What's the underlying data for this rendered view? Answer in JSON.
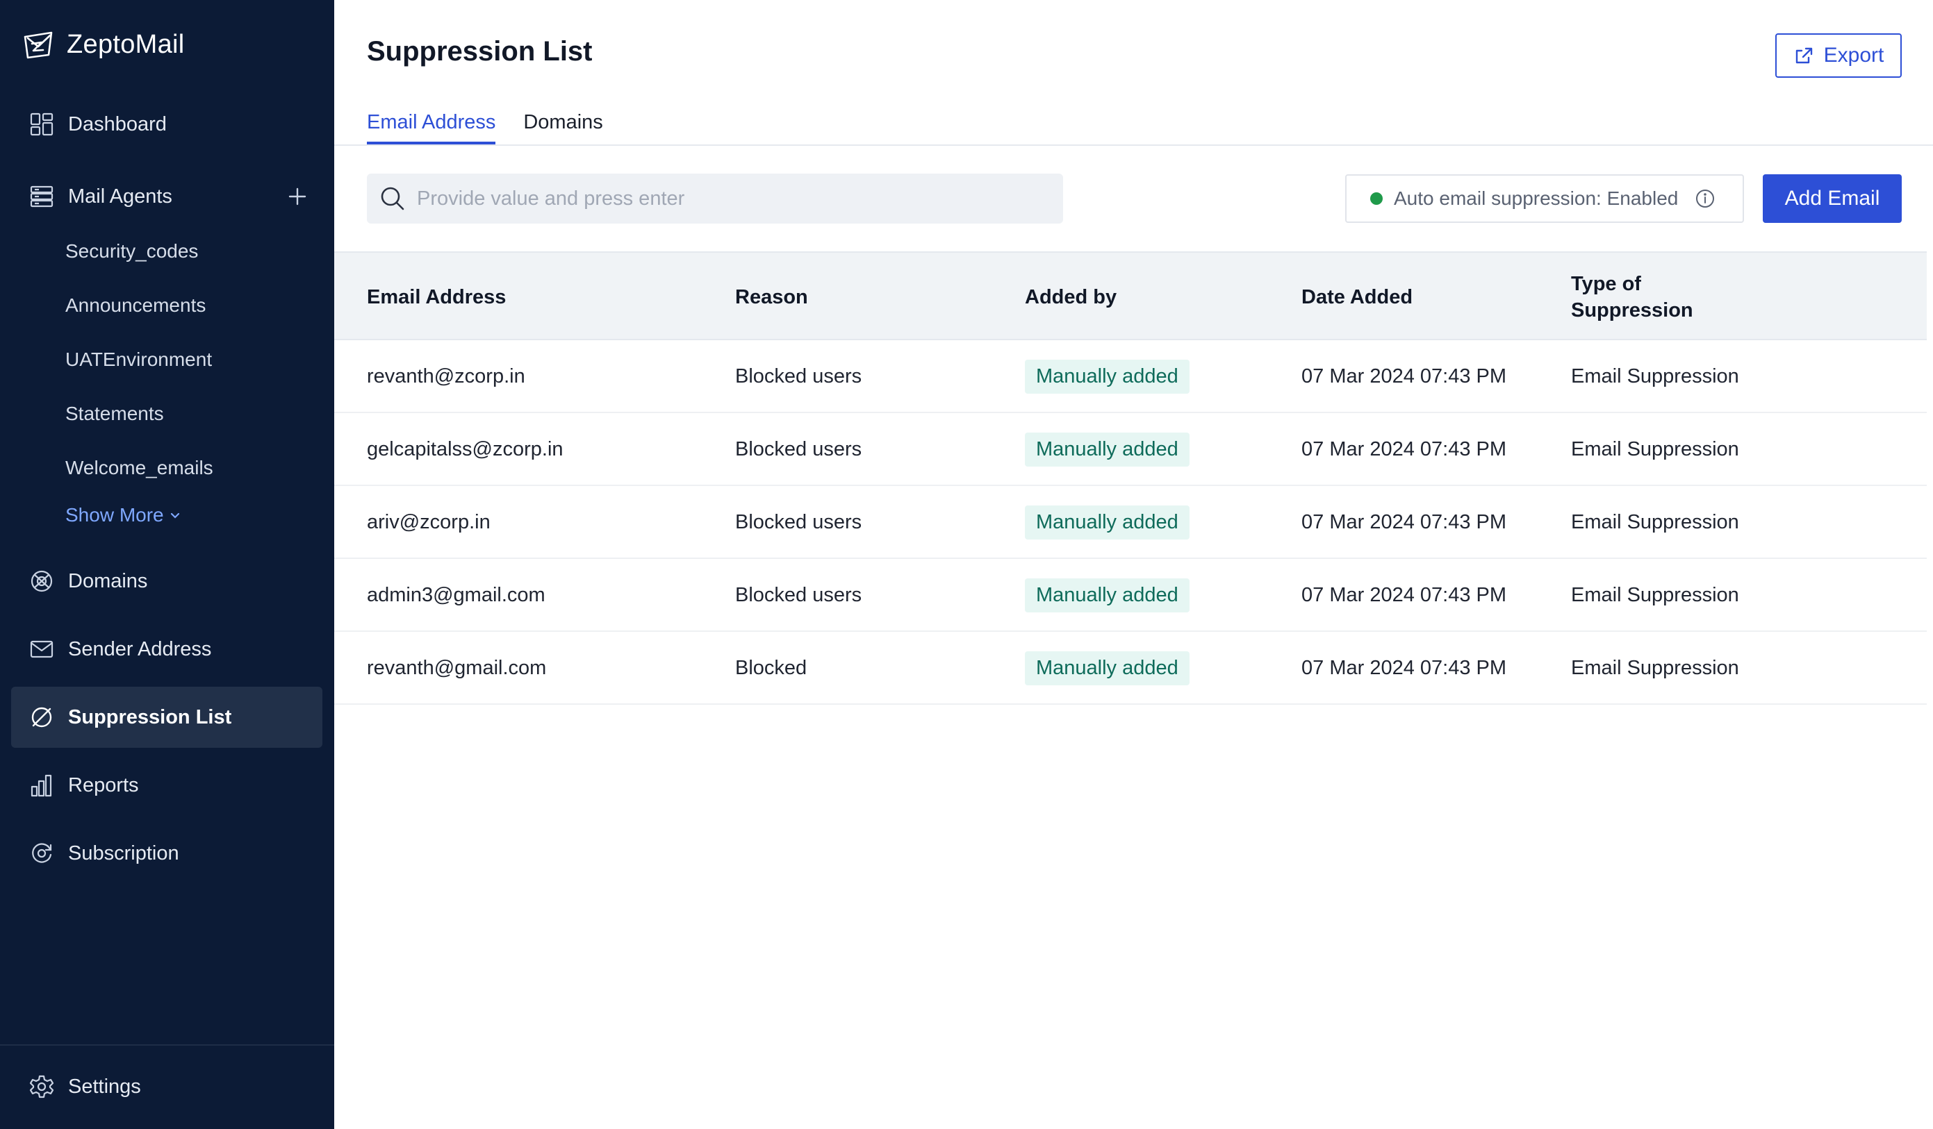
{
  "app": {
    "name": "ZeptoMail"
  },
  "sidebar": {
    "items": [
      {
        "label": "Dashboard",
        "icon": "dashboard-icon"
      },
      {
        "label": "Mail Agents",
        "icon": "mail-agents-icon"
      },
      {
        "label": "Domains",
        "icon": "domains-icon"
      },
      {
        "label": "Sender Address",
        "icon": "envelope-icon"
      },
      {
        "label": "Suppression List",
        "icon": "suppression-icon",
        "active": true
      },
      {
        "label": "Reports",
        "icon": "reports-icon"
      },
      {
        "label": "Subscription",
        "icon": "subscription-icon"
      }
    ],
    "agents": [
      "Security_codes",
      "Announcements",
      "UATEnvironment",
      "Statements",
      "Welcome_emails"
    ],
    "show_more": "Show More",
    "settings": "Settings"
  },
  "main": {
    "title": "Suppression List",
    "export_label": "Export",
    "tabs": [
      "Email Address",
      "Domains"
    ],
    "search_placeholder": "Provide value and press enter",
    "auto_suppression": "Auto email suppression: Enabled",
    "add_email": "Add Email",
    "columns": [
      "Email Address",
      "Reason",
      "Added by",
      "Date Added",
      "Type of Suppression"
    ],
    "rows": [
      {
        "email": "revanth@zcorp.in",
        "reason": "Blocked users",
        "added_by": "Manually added",
        "date": "07 Mar 2024 07:43 PM",
        "type": "Email Suppression"
      },
      {
        "email": "gelcapitalss@zcorp.in",
        "reason": "Blocked users",
        "added_by": "Manually added",
        "date": "07 Mar 2024 07:43 PM",
        "type": "Email Suppression"
      },
      {
        "email": "ariv@zcorp.in",
        "reason": "Blocked users",
        "added_by": "Manually added",
        "date": "07 Mar 2024 07:43 PM",
        "type": "Email Suppression"
      },
      {
        "email": "admin3@gmail.com",
        "reason": "Blocked users",
        "added_by": "Manually added",
        "date": "07 Mar 2024 07:43 PM",
        "type": "Email Suppression"
      },
      {
        "email": "revanth@gmail.com",
        "reason": "Blocked",
        "added_by": "Manually added",
        "date": "07 Mar 2024 07:43 PM",
        "type": "Email Suppression"
      }
    ]
  },
  "colors": {
    "sidebar_bg": "#0c1b36",
    "accent": "#2d4fd6",
    "badge_bg": "#e6f6f3",
    "badge_text": "#0e6b5a",
    "status_dot": "#1f9a4a"
  }
}
